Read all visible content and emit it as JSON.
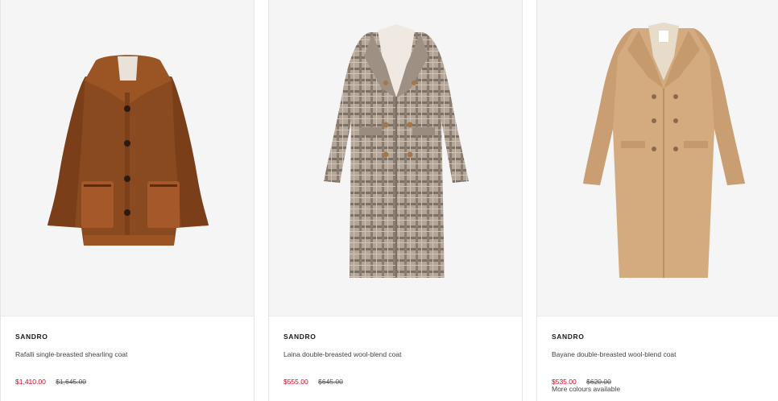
{
  "products": [
    {
      "brand": "SANDRO",
      "name": "Rafalli single-breasted shearling coat",
      "price": "$1,410.00",
      "was_price": "$1,645.00",
      "image": "brown-shearling-coat"
    },
    {
      "brand": "SANDRO",
      "name": "Laina double-breasted wool-blend coat",
      "price": "$555.00",
      "was_price": "$645.00",
      "image": "check-wool-coat"
    },
    {
      "brand": "SANDRO",
      "name": "Bayane double-breasted wool-blend coat",
      "price": "$535.00",
      "was_price": "$620.00",
      "more_colours": "More colours available",
      "image": "camel-wool-coat"
    }
  ],
  "colors": {
    "sale_price": "#d0021b",
    "image_bg": "#f5f5f5"
  }
}
